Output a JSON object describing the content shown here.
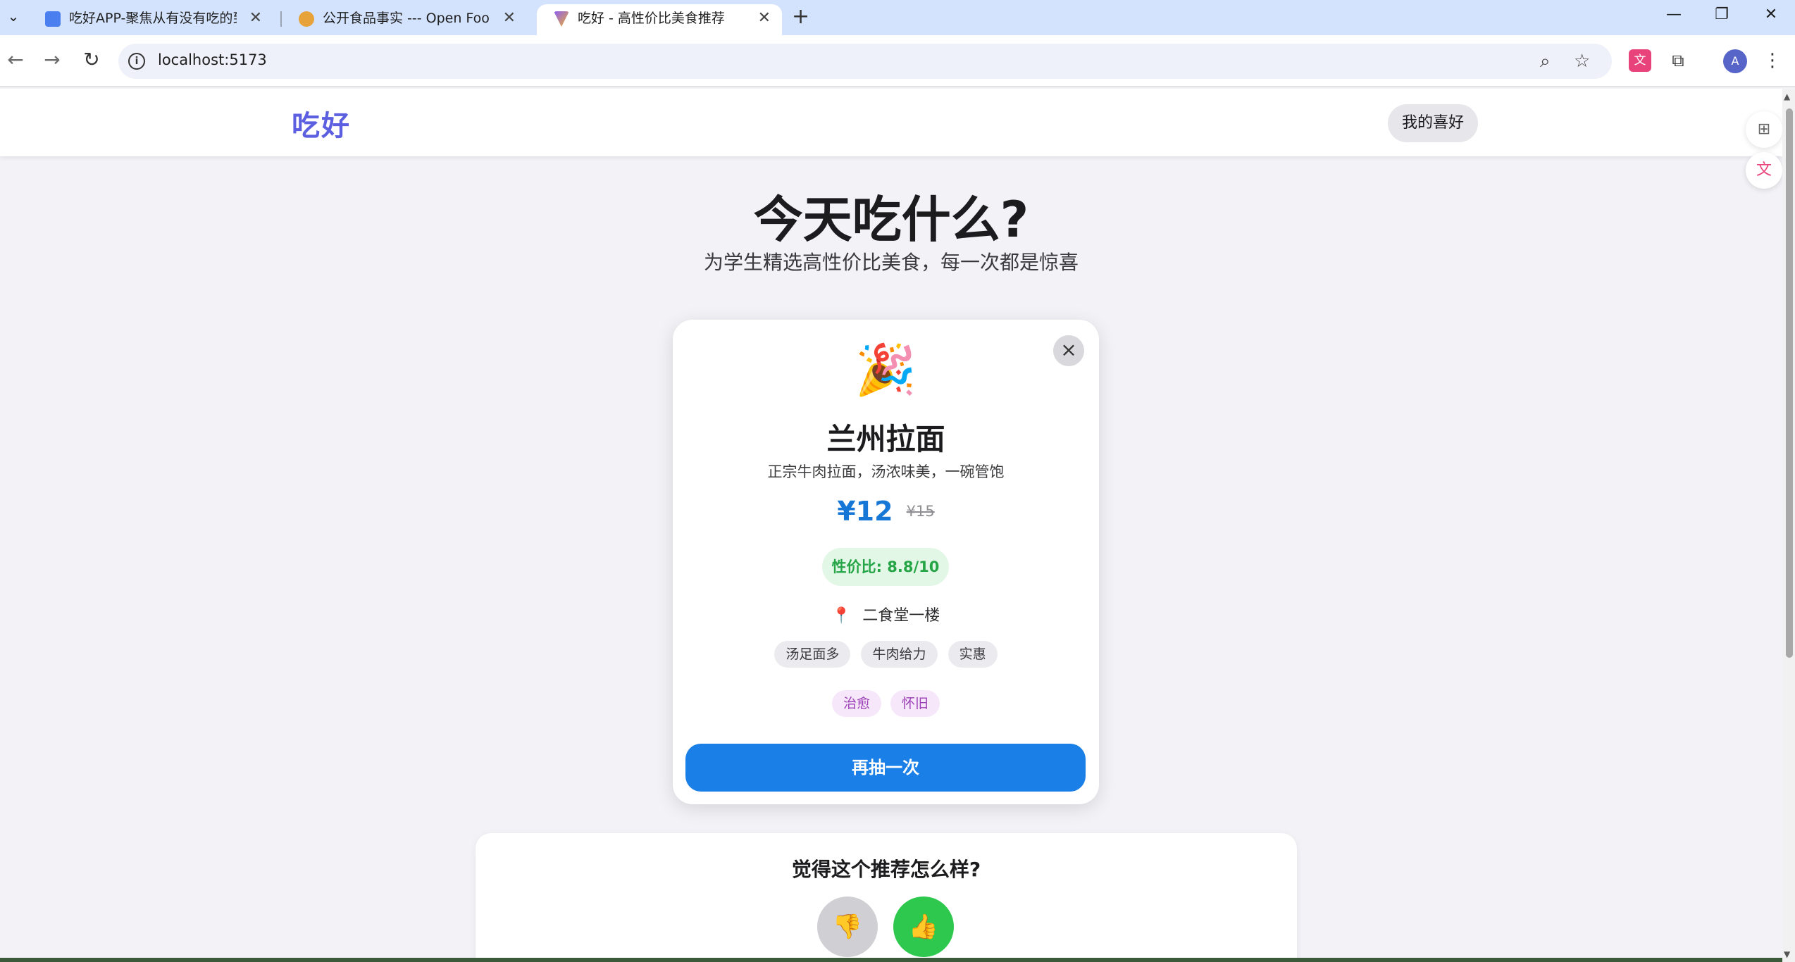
{
  "browser": {
    "tabs": [
      {
        "title": "吃好APP-聚焦从有没有吃的到吃",
        "favicon_color": "#4a7ff0",
        "active": false
      },
      {
        "title": "公开食品事实 --- Open Food Fa",
        "favicon_color": "#e8a23a",
        "active": false
      },
      {
        "title": "吃好 - 高性价比美食推荐",
        "favicon_color": "#8b5cf6",
        "active": true
      }
    ],
    "url": "localhost:5173",
    "avatar_letter": "A"
  },
  "site": {
    "logo": "吃好",
    "preferences_label": "我的喜好"
  },
  "hero": {
    "title": "今天吃什么?",
    "subtitle": "为学生精选高性价比美食，每一次都是惊喜"
  },
  "recommendation": {
    "emoji": "🎉",
    "name": "兰州拉面",
    "description": "正宗牛肉拉面，汤浓味美，一碗管饱",
    "price": "¥12",
    "original_price": "¥15",
    "value_score": "性价比: 8.8/10",
    "location_icon": "📍",
    "location": "二食堂一楼",
    "tags": [
      "汤足面多",
      "牛肉给力",
      "实惠"
    ],
    "moods": [
      "治愈",
      "怀旧"
    ],
    "redraw_label": "再抽一次",
    "close_icon": "×"
  },
  "feedback": {
    "question": "觉得这个推荐怎么样?",
    "dislike_icon": "👎",
    "like_icon": "👍"
  },
  "colors": {
    "accent_blue": "#1a7fe6",
    "value_green": "#26a547",
    "mood_purple": "#9b3fb5",
    "like_green": "#2dc84d"
  }
}
